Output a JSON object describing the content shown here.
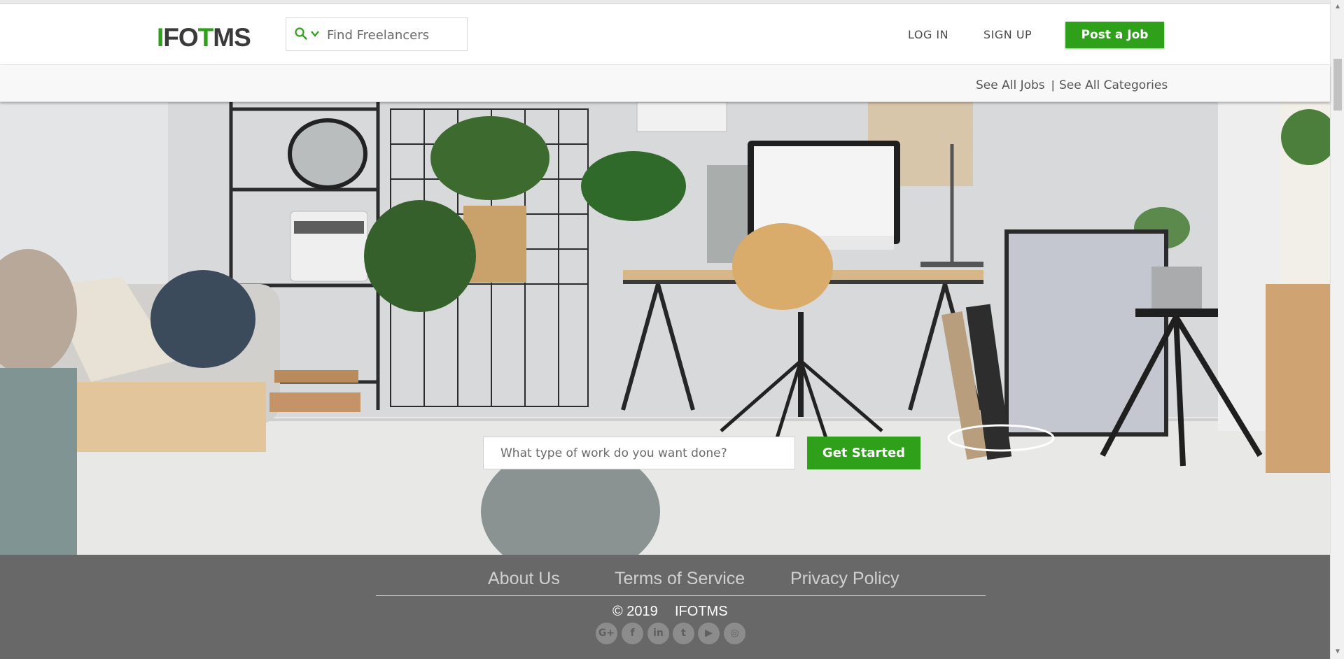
{
  "header": {
    "logo": {
      "part1": "I",
      "part2": "FO",
      "part3": "T",
      "part4": "MS"
    },
    "search_placeholder": "Find Freelancers",
    "login_label": "LOG IN",
    "signup_label": "SIGN UP",
    "post_job_label": "Post a Job"
  },
  "subnav": {
    "see_all_jobs": "See All Jobs",
    "separator": "|",
    "see_all_categories": "See All Categories"
  },
  "hero": {
    "input_placeholder": "What type of work do you want done?",
    "button_label": "Get Started"
  },
  "footer": {
    "links": [
      "About Us",
      "Terms of Service",
      "Privacy Policy"
    ],
    "copyright": "© 2019",
    "brand": "IFOTMS",
    "social_icons": [
      "google-plus-icon",
      "facebook-icon",
      "linkedin-icon",
      "twitter-icon",
      "youtube-icon",
      "instagram-icon"
    ],
    "social_glyphs": [
      "G+",
      "f",
      "in",
      "t",
      "▶",
      "◎"
    ]
  },
  "colors": {
    "brand_green": "#2ea01a",
    "footer_bg": "#686868",
    "text_dark": "#4a4a4a"
  }
}
